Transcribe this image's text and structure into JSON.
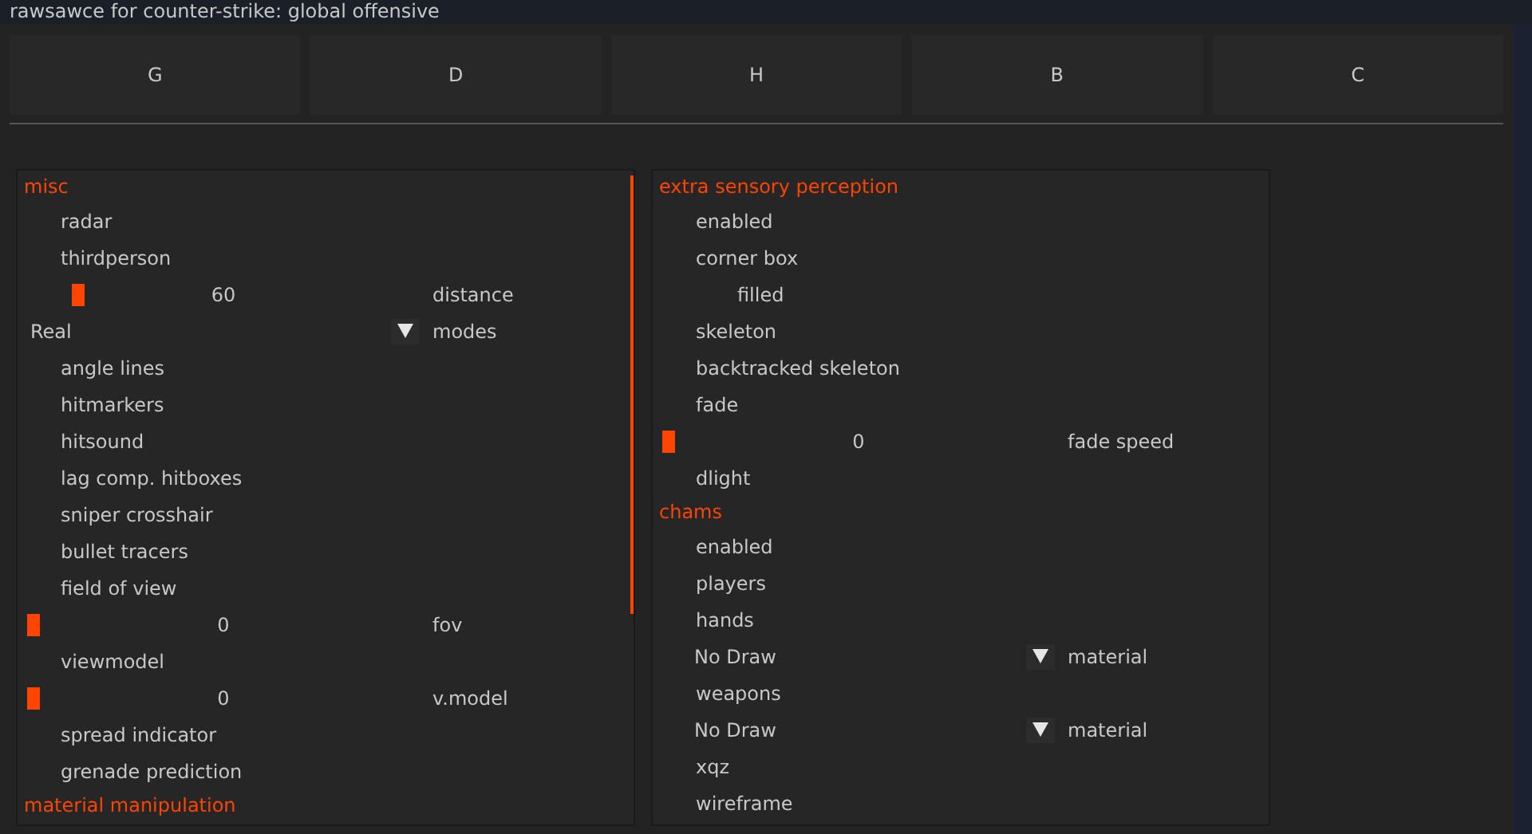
{
  "window": {
    "title": "rawsawce for counter-strike: global offensive"
  },
  "tabs": [
    {
      "label": "G"
    },
    {
      "label": "D"
    },
    {
      "label": "H"
    },
    {
      "label": "B"
    },
    {
      "label": "C"
    }
  ],
  "panels": [
    {
      "items": [
        {
          "kind": "header",
          "label": "misc"
        },
        {
          "kind": "check",
          "label": "radar"
        },
        {
          "kind": "check",
          "label": "thirdperson"
        },
        {
          "kind": "slider",
          "reading": "60",
          "label": "distance",
          "level": 0.12
        },
        {
          "kind": "combo",
          "selection": "Real",
          "label": "modes"
        },
        {
          "kind": "check",
          "label": "angle lines"
        },
        {
          "kind": "check",
          "label": "hitmarkers"
        },
        {
          "kind": "check",
          "label": "hitsound"
        },
        {
          "kind": "check",
          "label": "lag comp. hitboxes"
        },
        {
          "kind": "check",
          "label": "sniper crosshair"
        },
        {
          "kind": "check",
          "label": "bullet tracers"
        },
        {
          "kind": "check",
          "label": "field of view"
        },
        {
          "kind": "slider",
          "reading": "0",
          "label": "fov",
          "level": 0
        },
        {
          "kind": "check",
          "label": "viewmodel"
        },
        {
          "kind": "slider",
          "reading": "0",
          "label": "v.model",
          "level": 0
        },
        {
          "kind": "check",
          "label": "spread indicator"
        },
        {
          "kind": "check",
          "label": "grenade prediction"
        },
        {
          "kind": "header",
          "label": "material manipulation"
        }
      ]
    },
    {
      "items": [
        {
          "kind": "header",
          "label": "extra sensory perception"
        },
        {
          "kind": "check",
          "label": "enabled"
        },
        {
          "kind": "check",
          "label": "corner box",
          "children": [
            {
              "kind": "check",
              "label": "filled"
            }
          ]
        },
        {
          "kind": "check",
          "label": "skeleton"
        },
        {
          "kind": "check",
          "label": "backtracked skeleton"
        },
        {
          "kind": "check",
          "label": "fade"
        },
        {
          "kind": "slider",
          "reading": "0",
          "label": "fade speed",
          "level": 0
        },
        {
          "kind": "check",
          "label": "dlight"
        },
        {
          "kind": "header",
          "label": "chams"
        },
        {
          "kind": "check",
          "label": "enabled"
        },
        {
          "kind": "check",
          "label": "players"
        },
        {
          "kind": "check",
          "label": "hands"
        },
        {
          "kind": "combo",
          "selection": "No Draw",
          "label": "material"
        },
        {
          "kind": "check",
          "label": "weapons"
        },
        {
          "kind": "combo",
          "selection": "No Draw",
          "label": "material"
        },
        {
          "kind": "check",
          "label": "xqz"
        },
        {
          "kind": "check",
          "label": "wireframe"
        }
      ]
    }
  ]
}
